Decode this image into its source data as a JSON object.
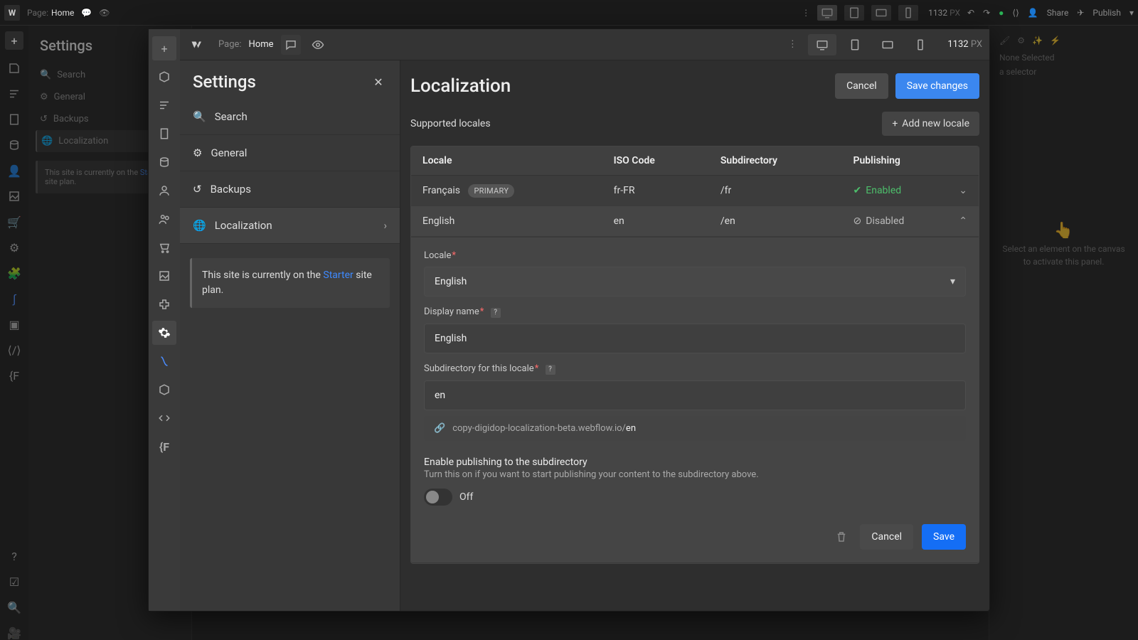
{
  "top": {
    "page_label": "Page:",
    "page_name": "Home",
    "width": "1132",
    "px": "PX",
    "share": "Share",
    "publish": "Publish"
  },
  "bg_sidebar": {
    "title": "Settings",
    "search": "Search",
    "items": {
      "general": "General",
      "backups": "Backups",
      "localization": "Localization"
    },
    "note_prefix": "This site is currently on the ",
    "note_plan": "Starter",
    "note_suffix": " site plan."
  },
  "bg_right": {
    "none_selected": "None Selected",
    "selector_hint": "a selector",
    "hint1": "Select an element on the canvas",
    "hint2": "to activate this panel."
  },
  "modal": {
    "top": {
      "page_label": "Page:",
      "page_name": "Home",
      "width": "1132",
      "px": "PX"
    },
    "settings": {
      "title": "Settings",
      "search": "Search",
      "general": "General",
      "backups": "Backups",
      "localization": "Localization",
      "note_prefix": "This site is currently on the ",
      "note_plan": "Starter",
      "note_suffix": " site plan."
    },
    "panel": {
      "title": "Localization",
      "cancel": "Cancel",
      "save_changes": "Save changes",
      "supported": "Supported locales",
      "add_locale": "Add new locale",
      "cols": {
        "locale": "Locale",
        "iso": "ISO Code",
        "subdir": "Subdirectory",
        "pub": "Publishing"
      },
      "rows": [
        {
          "name": "Français",
          "primary": "PRIMARY",
          "iso": "fr-FR",
          "subdir": "/fr",
          "pub": "Enabled"
        },
        {
          "name": "English",
          "primary": "",
          "iso": "en",
          "subdir": "/en",
          "pub": "Disabled"
        }
      ],
      "form": {
        "locale_label": "Locale",
        "locale_value": "English",
        "display_label": "Display name",
        "display_value": "English",
        "subdir_label": "Subdirectory for this locale",
        "subdir_value": "en",
        "url_base": "copy-digidop-localization-beta.webflow.io/",
        "url_suffix": "en",
        "enable_title": "Enable publishing to the subdirectory",
        "enable_desc": "Turn this on if you want to start publishing your content to the subdirectory above.",
        "toggle_state": "Off",
        "cancel": "Cancel",
        "save": "Save"
      }
    }
  }
}
